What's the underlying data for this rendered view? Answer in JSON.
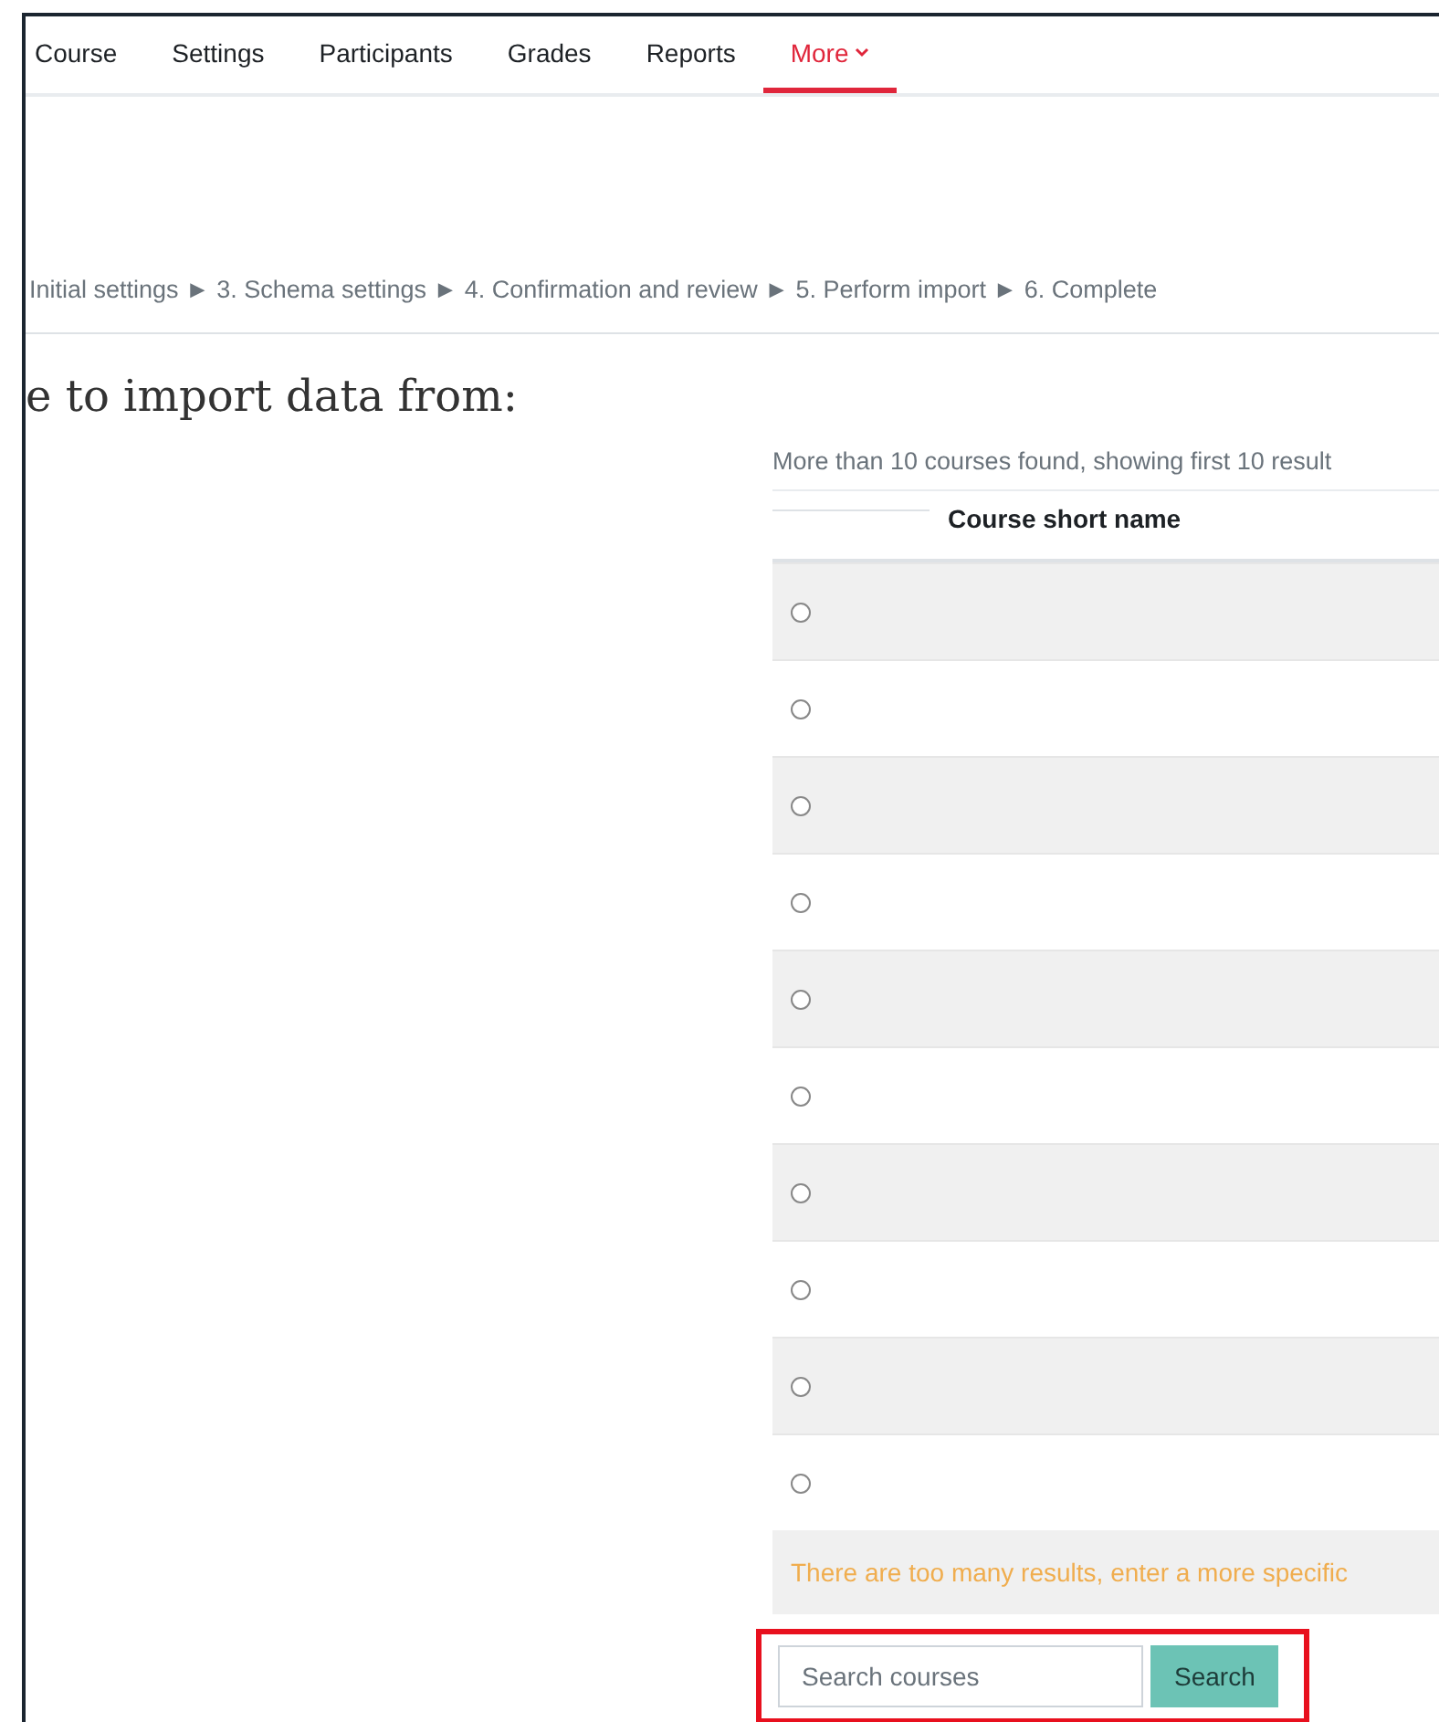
{
  "nav": {
    "tabs": [
      {
        "label": "Course",
        "selected": false
      },
      {
        "label": "Settings",
        "selected": false
      },
      {
        "label": "Participants",
        "selected": false
      },
      {
        "label": "Grades",
        "selected": false
      },
      {
        "label": "Reports",
        "selected": false
      },
      {
        "label": "More",
        "selected": true,
        "dropdown": true
      }
    ]
  },
  "steps": "Initial settings ► 3. Schema settings ► 4. Confirmation and review ► 5. Perform import ► 6. Complete",
  "heading": "e to import data from:",
  "results": {
    "info": "More than 10 courses found, showing first 10 result",
    "columns": [
      "Course short name"
    ],
    "rows": [
      {
        "selected": false
      },
      {
        "selected": false
      },
      {
        "selected": false
      },
      {
        "selected": false
      },
      {
        "selected": false
      },
      {
        "selected": false
      },
      {
        "selected": false
      },
      {
        "selected": false
      },
      {
        "selected": false
      },
      {
        "selected": false
      }
    ],
    "warning": "There are too many results, enter a more specific"
  },
  "search": {
    "placeholder": "Search courses",
    "button": "Search",
    "highlighted": true
  }
}
